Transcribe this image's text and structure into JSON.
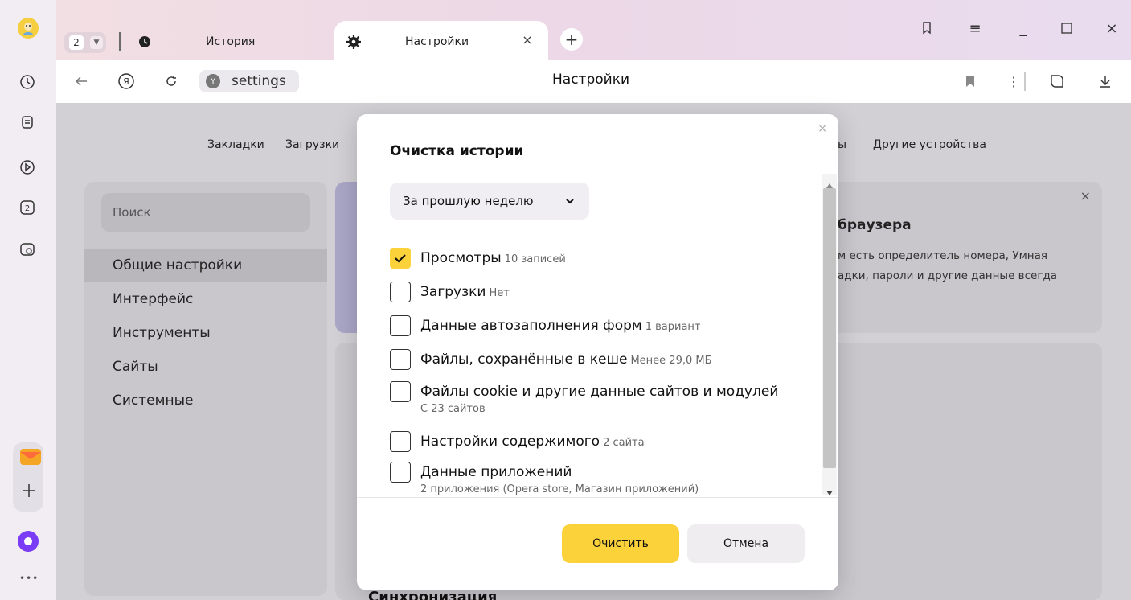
{
  "tabs": {
    "counter": "2",
    "history_label": "История",
    "settings_label": "Настройки"
  },
  "address": {
    "url": "settings",
    "page_title": "Настройки"
  },
  "topnav": {
    "bookmarks": "Закладки",
    "downloads": "Загрузки",
    "partial": "ы",
    "other_devices": "Другие устройства"
  },
  "sidebar": {
    "search_placeholder": "Поиск",
    "items": [
      "Общие настройки",
      "Интерфейс",
      "Инструменты",
      "Сайты",
      "Системные"
    ]
  },
  "promo": {
    "title": "браузера",
    "text_line1": "м есть определитель номера, Умная",
    "text_line2": "адки, пароли и другие данные всегда"
  },
  "sync_heading": "Синхронизация",
  "dialog": {
    "title": "Очистка истории",
    "period": "За прошлую неделю",
    "options": [
      {
        "label": "Просмотры",
        "detail": "10 записей",
        "checked": true
      },
      {
        "label": "Загрузки",
        "detail": "Нет",
        "checked": false
      },
      {
        "label": "Данные автозаполнения форм",
        "detail": "1 вариант",
        "checked": false
      },
      {
        "label": "Файлы, сохранённые в кеше",
        "detail": "Менее 29,0 МБ",
        "checked": false
      },
      {
        "label": "Файлы cookie и другие данные сайтов и модулей",
        "detail": "С 23 сайтов",
        "checked": false
      },
      {
        "label": "Настройки содержимого",
        "detail": "2 сайта",
        "checked": false
      },
      {
        "label": "Данные приложений",
        "detail": "2 приложения (Opera store, Магазин приложений)",
        "checked": false
      }
    ],
    "clear_label": "Очистить",
    "cancel_label": "Отмена"
  },
  "colors": {
    "accent_yellow": "#fcd23b",
    "alice_purple": "#7b3cf5"
  }
}
